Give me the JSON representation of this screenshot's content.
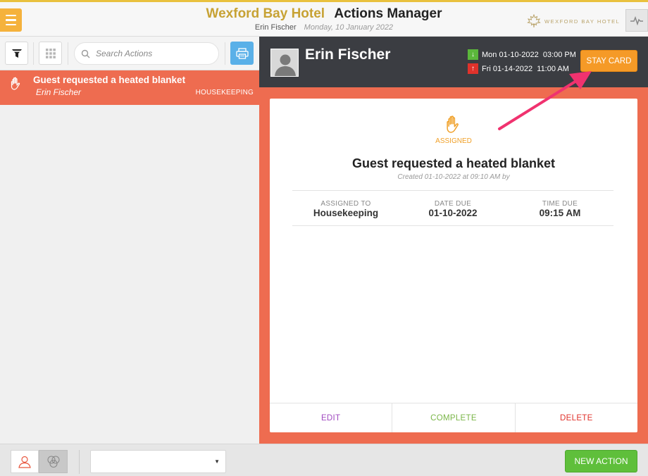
{
  "header": {
    "hotel_name": "Wexford Bay Hotel",
    "app_title": "Actions Manager",
    "user_name": "Erin Fischer",
    "date": "Monday, 10 January 2022",
    "logo_text": "WEXFORD BAY HOTEL"
  },
  "toolbar": {
    "search_placeholder": "Search Actions"
  },
  "actions_list": [
    {
      "title": "Guest requested a heated blanket",
      "user": "Erin Fischer",
      "department": "HOUSEKEEPING",
      "icon": "hand-icon"
    }
  ],
  "detail": {
    "guest_name": "Erin Fischer",
    "arrival": "Mon 01-10-2022  03:00 PM",
    "departure": "Fri 01-14-2022  11:00 AM",
    "stay_card_label": "STAY CARD",
    "status": "ASSIGNED",
    "title": "Guest requested a heated blanket",
    "created": "Created 01-10-2022 at 09:10 AM by",
    "meta": [
      {
        "label": "ASSIGNED TO",
        "value": "Housekeeping"
      },
      {
        "label": "DATE DUE",
        "value": "01-10-2022"
      },
      {
        "label": "TIME DUE",
        "value": "09:15 AM"
      }
    ],
    "actions": {
      "edit": "EDIT",
      "complete": "COMPLETE",
      "delete": "DELETE"
    }
  },
  "footer": {
    "select_value": "",
    "new_action_label": "NEW ACTION"
  },
  "colors": {
    "accent_orange": "#f59a27",
    "selected_row": "#ee6c50",
    "dark_header": "#3b3d42",
    "green": "#5fbf3b",
    "red": "#e0322b",
    "purple": "#a04ac0",
    "hotel_gold": "#c7a234",
    "annotation_arrow": "#f0326f"
  }
}
